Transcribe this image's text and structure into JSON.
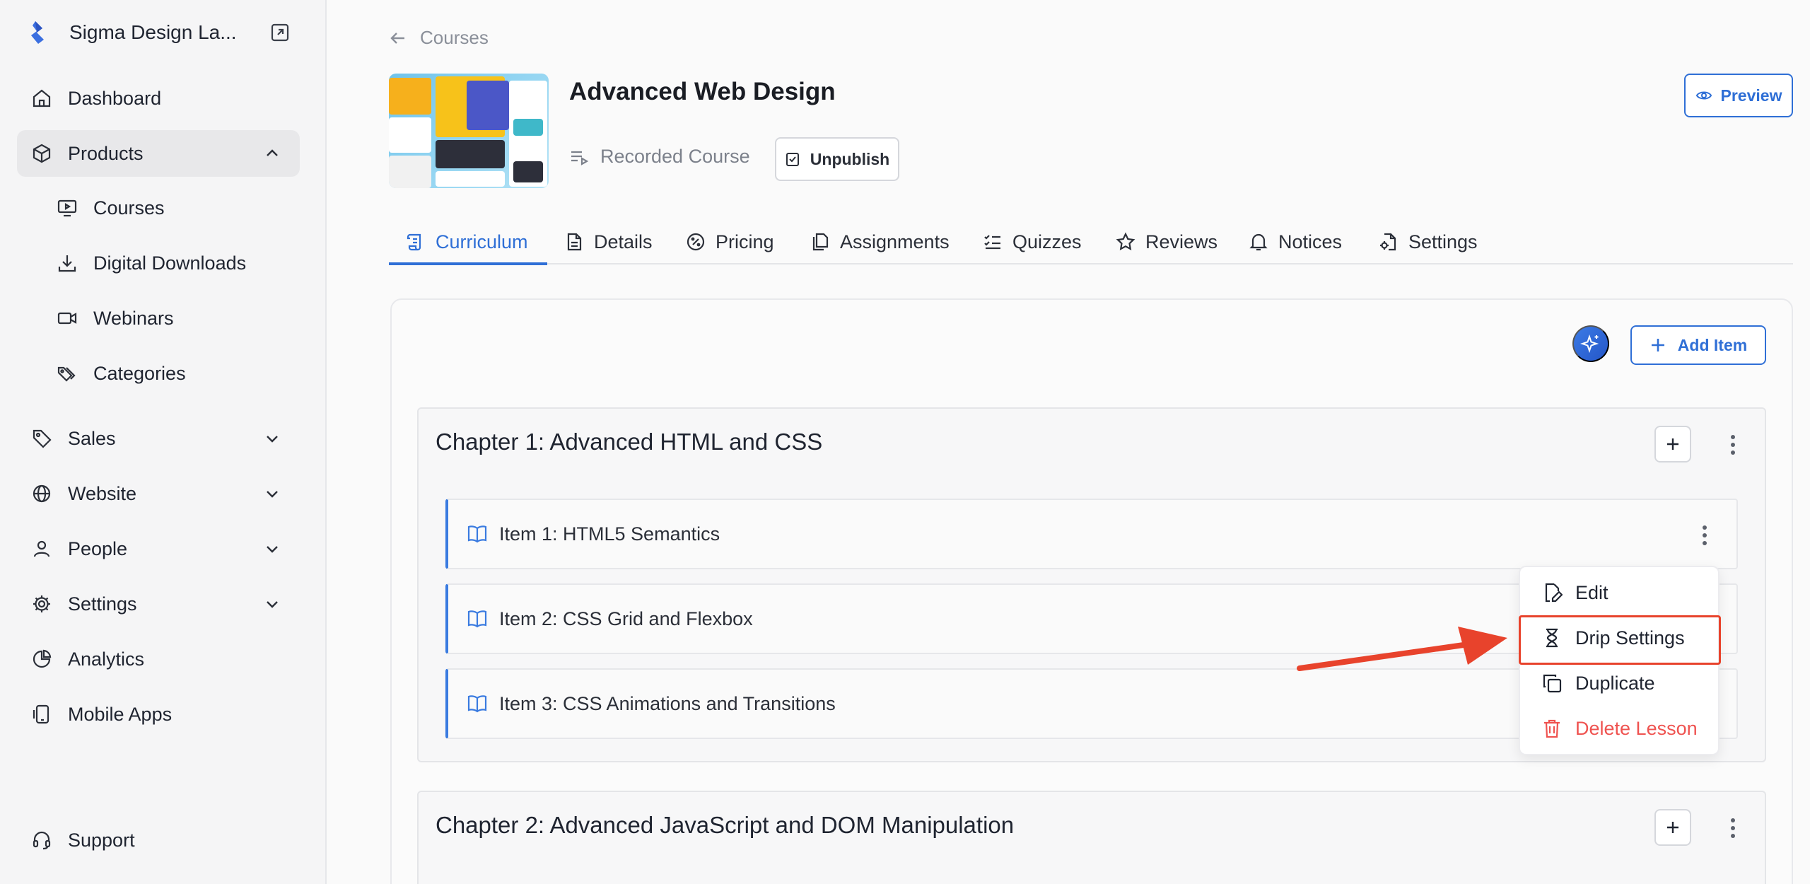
{
  "sidebar": {
    "brand": "Sigma Design La...",
    "nav": [
      {
        "label": "Dashboard"
      },
      {
        "label": "Products"
      },
      {
        "label": "Sales"
      },
      {
        "label": "Website"
      },
      {
        "label": "People"
      },
      {
        "label": "Settings"
      },
      {
        "label": "Analytics"
      },
      {
        "label": "Mobile Apps"
      }
    ],
    "products_sub": [
      {
        "label": "Courses"
      },
      {
        "label": "Digital Downloads"
      },
      {
        "label": "Webinars"
      },
      {
        "label": "Categories"
      }
    ],
    "support": "Support"
  },
  "header": {
    "breadcrumb": "Courses",
    "title": "Advanced Web Design",
    "type": "Recorded Course",
    "unpublish_label": "Unpublish",
    "preview_label": "Preview"
  },
  "tabs": [
    {
      "label": "Curriculum"
    },
    {
      "label": "Details"
    },
    {
      "label": "Pricing"
    },
    {
      "label": "Assignments"
    },
    {
      "label": "Quizzes"
    },
    {
      "label": "Reviews"
    },
    {
      "label": "Notices"
    },
    {
      "label": "Settings"
    }
  ],
  "curriculum": {
    "add_item_label": "Add Item",
    "chapters": [
      {
        "title": "Chapter 1: Advanced HTML and CSS",
        "items": [
          {
            "label": "Item 1: HTML5 Semantics"
          },
          {
            "label": "Item 2: CSS Grid and Flexbox"
          },
          {
            "label": "Item 3: CSS Animations and Transitions"
          }
        ]
      },
      {
        "title": "Chapter 2: Advanced JavaScript and DOM Manipulation",
        "items": []
      }
    ]
  },
  "context_menu": {
    "items": [
      {
        "label": "Edit"
      },
      {
        "label": "Drip Settings"
      },
      {
        "label": "Duplicate"
      },
      {
        "label": "Delete Lesson"
      }
    ],
    "highlighted": "Drip Settings"
  },
  "colors": {
    "accent": "#2f6fd6",
    "danger": "#ef5350",
    "annotation": "#e8432c"
  }
}
